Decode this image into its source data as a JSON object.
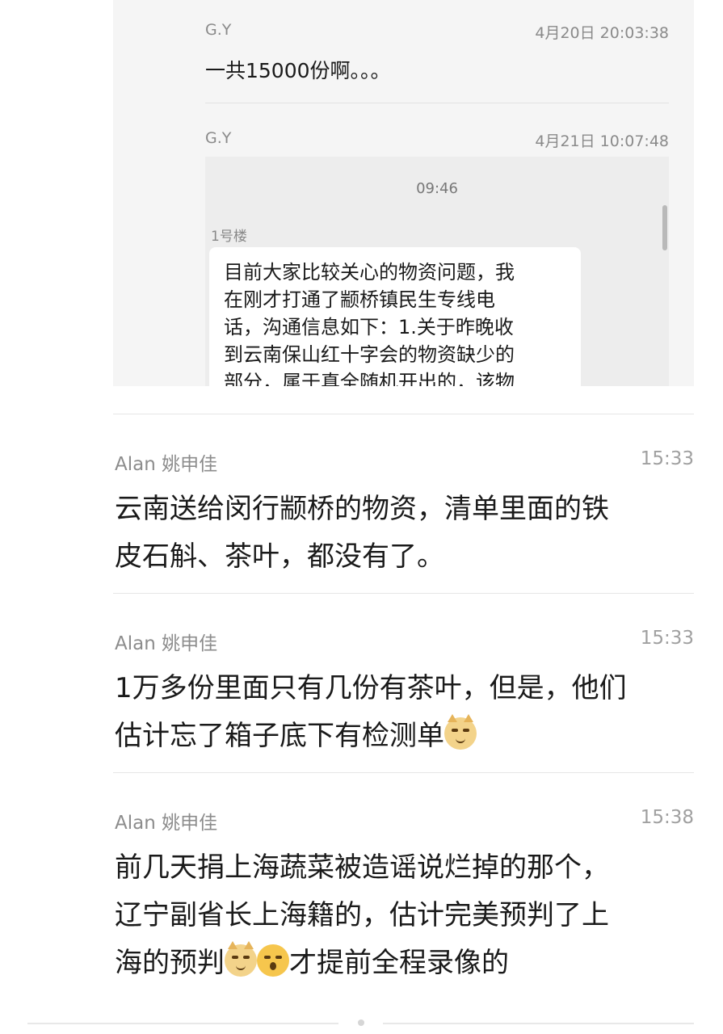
{
  "quoted": {
    "messages": [
      {
        "sender": "G.Y",
        "time": "4月20日 20:03:38",
        "text": "一共15000份啊。。。"
      },
      {
        "sender": "G.Y",
        "time": "4月21日 10:07:48"
      }
    ],
    "embedded": {
      "time": "09:46",
      "group": "1号楼",
      "lines": [
        "目前大家比较关心的物资问题，我",
        "在刚才打通了颛桥镇民生专线电",
        "话，沟通信息如下：1.关于昨晚收",
        "到云南保山红十字会的物资缺少的",
        "部分，属于真全随机开出的，该物"
      ]
    }
  },
  "comments": [
    {
      "sender": "Alan 姚申佳",
      "time": "15:33",
      "lines": [
        "云南送给闵行颛桥的物资，清单里面的铁",
        "皮石斛、茶叶，都没有了。"
      ]
    },
    {
      "sender": "Alan 姚申佳",
      "time": "15:33",
      "lines": [
        "1万多份里面只有几份有茶叶，但是，他们",
        "估计忘了箱子底下有检测单"
      ]
    },
    {
      "sender": "Alan 姚申佳",
      "time": "15:38",
      "lines": [
        "前几天捐上海蔬菜被造谣说烂掉的那个，",
        "辽宁副省长上海籍的，估计完美预判了上",
        "海的预判",
        "才提前全程录像的"
      ]
    }
  ]
}
